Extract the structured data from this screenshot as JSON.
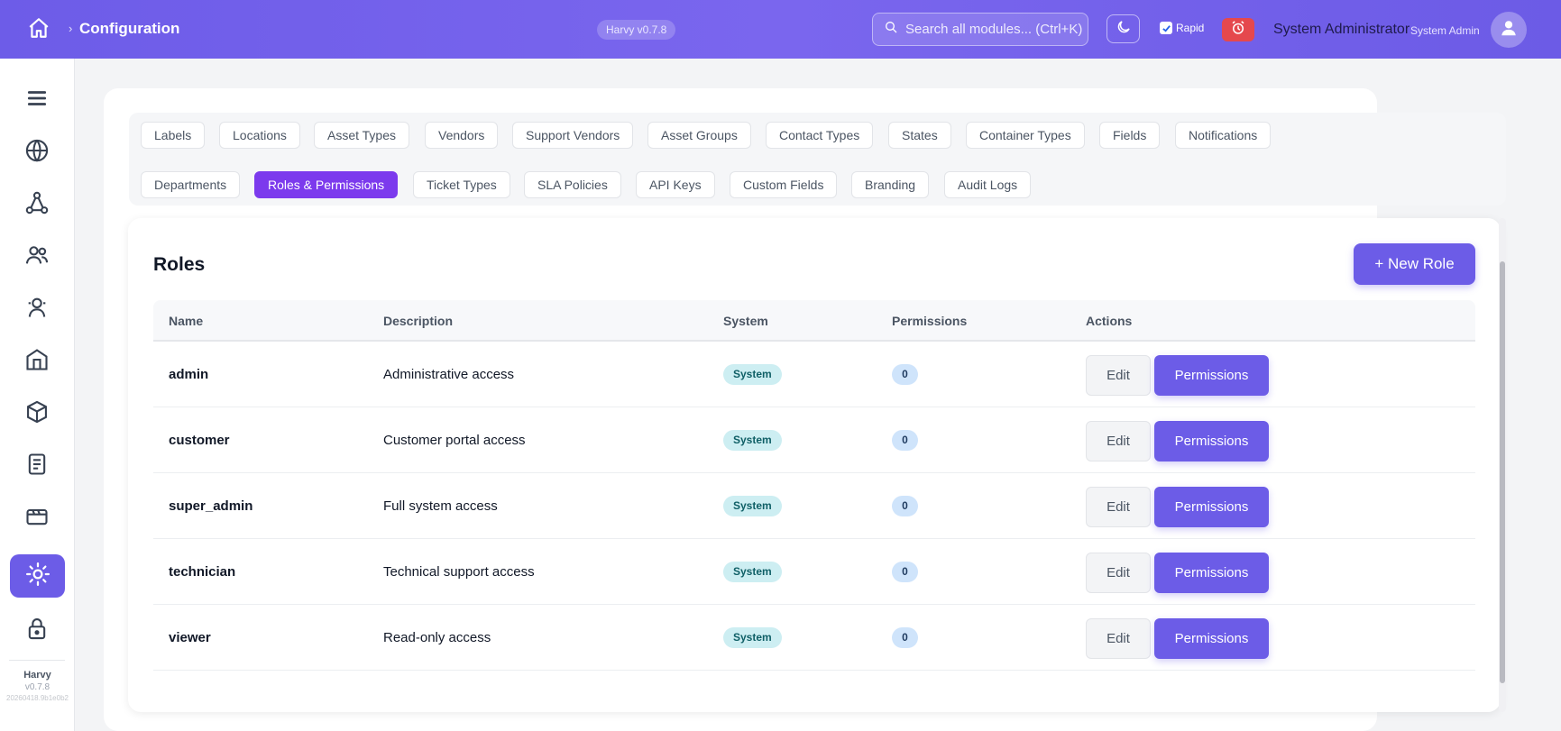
{
  "header": {
    "breadcrumb": "Configuration",
    "breadcrumb_sep": "›",
    "version": "Harvy v0.7.8",
    "search_placeholder": "Search all modules... (Ctrl+K)",
    "rapid_label": "Rapid",
    "rapid_checked": true,
    "user_name": "System Administrator",
    "user_role": "System Admin",
    "icons": [
      "home-icon",
      "search-icon",
      "moon-icon",
      "alarm-clock-icon",
      "user-icon"
    ]
  },
  "sidebar": {
    "items": [
      {
        "icon": "menu-icon"
      },
      {
        "icon": "globe-icon"
      },
      {
        "icon": "network-icon"
      },
      {
        "icon": "users-icon"
      },
      {
        "icon": "agent-icon"
      },
      {
        "icon": "building-icon"
      },
      {
        "icon": "package-icon"
      },
      {
        "icon": "document-icon"
      },
      {
        "icon": "ticket-icon"
      },
      {
        "icon": "settings-icon",
        "active": true
      },
      {
        "icon": "lock-icon"
      }
    ],
    "footer": {
      "app": "Harvy",
      "version": "v0.7.8",
      "build": "20260418.9b1e0b2"
    }
  },
  "tabs": {
    "row1": [
      "Labels",
      "Locations",
      "Asset Types",
      "Vendors",
      "Support Vendors",
      "Asset Groups",
      "Contact Types",
      "States",
      "Container Types",
      "Fields",
      "Notifications"
    ],
    "row2": [
      "Departments",
      "Roles & Permissions",
      "Ticket Types",
      "SLA Policies",
      "API Keys",
      "Custom Fields",
      "Branding",
      "Audit Logs"
    ],
    "active": "Roles & Permissions"
  },
  "roles": {
    "title": "Roles",
    "new_button": "+ New Role",
    "columns": [
      "Name",
      "Description",
      "System",
      "Permissions",
      "Actions"
    ],
    "rows": [
      {
        "name": "admin",
        "description": "Administrative access",
        "system": "System",
        "permissions": "0"
      },
      {
        "name": "customer",
        "description": "Customer portal access",
        "system": "System",
        "permissions": "0"
      },
      {
        "name": "super_admin",
        "description": "Full system access",
        "system": "System",
        "permissions": "0"
      },
      {
        "name": "technician",
        "description": "Technical support access",
        "system": "System",
        "permissions": "0"
      },
      {
        "name": "viewer",
        "description": "Read-only access",
        "system": "System",
        "permissions": "0"
      }
    ],
    "edit_label": "Edit",
    "permissions_label": "Permissions"
  },
  "colors": {
    "accent": "#6c5ce7",
    "active_tab": "#7c3aed",
    "alarm": "#e5484d"
  }
}
